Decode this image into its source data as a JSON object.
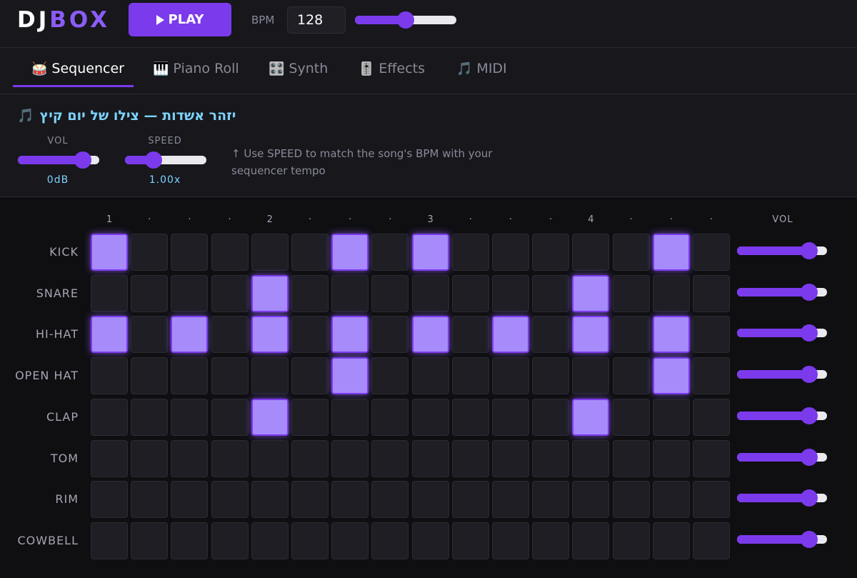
{
  "app": {
    "logo_dj": "DJ",
    "logo_box": "BOX",
    "play_label": "PLAY",
    "bpm_label": "BPM",
    "bpm_value": "128",
    "bpm_slider_fraction": 0.5
  },
  "tabs": [
    {
      "icon": "🥁",
      "icon_name": "drum-icon",
      "label": "Sequencer",
      "active": true
    },
    {
      "icon": "🎹",
      "icon_name": "piano-keys-icon",
      "label": "Piano Roll",
      "active": false
    },
    {
      "icon": "🎛️",
      "icon_name": "control-knobs-icon",
      "label": "Synth",
      "active": false
    },
    {
      "icon": "🎚️",
      "icon_name": "level-slider-icon",
      "label": "Effects",
      "active": false
    },
    {
      "icon": "🎵",
      "icon_name": "music-note-icon",
      "label": "MIDI",
      "active": false
    }
  ],
  "song": {
    "note_icon": "🎵",
    "title": "יזהר אשדות — צילו של יום קיץ",
    "vol_label": "VOL",
    "vol_value": "0dB",
    "vol_fraction": 0.8,
    "speed_label": "SPEED",
    "speed_value": "1.00x",
    "speed_fraction": 0.35,
    "hint": "↑ Use SPEED to match the song's BPM with your sequencer tempo"
  },
  "sequencer": {
    "step_labels": [
      "1",
      "·",
      "·",
      "·",
      "2",
      "·",
      "·",
      "·",
      "3",
      "·",
      "·",
      "·",
      "4",
      "·",
      "·",
      "·"
    ],
    "vol_header": "VOL",
    "tracks": [
      {
        "name": "KICK",
        "steps": [
          1,
          0,
          0,
          0,
          0,
          0,
          1,
          0,
          1,
          0,
          0,
          0,
          0,
          0,
          1,
          0
        ],
        "volume": 0.8
      },
      {
        "name": "SNARE",
        "steps": [
          0,
          0,
          0,
          0,
          1,
          0,
          0,
          0,
          0,
          0,
          0,
          0,
          1,
          0,
          0,
          0
        ],
        "volume": 0.8
      },
      {
        "name": "HI-HAT",
        "steps": [
          1,
          0,
          1,
          0,
          1,
          0,
          1,
          0,
          1,
          0,
          1,
          0,
          1,
          0,
          1,
          0
        ],
        "volume": 0.8
      },
      {
        "name": "OPEN HAT",
        "steps": [
          0,
          0,
          0,
          0,
          0,
          0,
          1,
          0,
          0,
          0,
          0,
          0,
          0,
          0,
          1,
          0
        ],
        "volume": 0.8
      },
      {
        "name": "CLAP",
        "steps": [
          0,
          0,
          0,
          0,
          1,
          0,
          0,
          0,
          0,
          0,
          0,
          0,
          1,
          0,
          0,
          0
        ],
        "volume": 0.8
      },
      {
        "name": "TOM",
        "steps": [
          0,
          0,
          0,
          0,
          0,
          0,
          0,
          0,
          0,
          0,
          0,
          0,
          0,
          0,
          0,
          0
        ],
        "volume": 0.8
      },
      {
        "name": "RIM",
        "steps": [
          0,
          0,
          0,
          0,
          0,
          0,
          0,
          0,
          0,
          0,
          0,
          0,
          0,
          0,
          0,
          0
        ],
        "volume": 0.8
      },
      {
        "name": "COWBELL",
        "steps": [
          0,
          0,
          0,
          0,
          0,
          0,
          0,
          0,
          0,
          0,
          0,
          0,
          0,
          0,
          0,
          0
        ],
        "volume": 0.8
      }
    ]
  },
  "colors": {
    "accent": "#7c3aed",
    "cell_on": "#a78bfa",
    "cell_off": "#1e1e24",
    "song_text": "#7dd3fc"
  }
}
